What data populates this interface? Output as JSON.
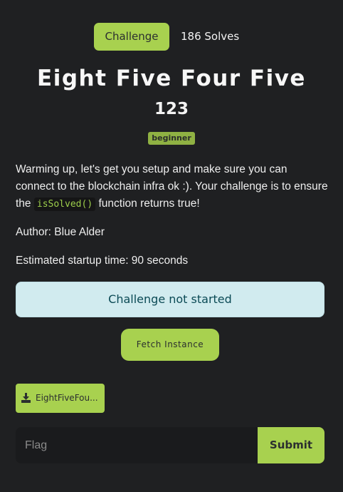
{
  "tabs": {
    "challenge_label": "Challenge",
    "solves_label": "186 Solves"
  },
  "challenge": {
    "title": "Eight Five Four Five",
    "points": "123",
    "tag": "beginner",
    "description_part1": "Warming up, let's get you setup and make sure you can connect to the blockchain infra ok :). Your challenge is to ensure the",
    "description_code": "isSolved()",
    "description_part2": "function returns true!",
    "author": "Author: Blue Alder",
    "startup_time": "Estimated startup time: 90 seconds"
  },
  "instance": {
    "status": "Challenge not started",
    "fetch_label": "Fetch Instance"
  },
  "files": [
    {
      "name": "EightFiveFou...",
      "icon": "download-icon"
    }
  ],
  "flag_form": {
    "placeholder": "Flag",
    "value": "",
    "submit_label": "Submit"
  },
  "colors": {
    "background": "#1f2022",
    "accent": "#a8d14f",
    "status_bg": "#d1ebef",
    "status_text": "#0b4a55",
    "code_text": "#9ccd4b"
  }
}
